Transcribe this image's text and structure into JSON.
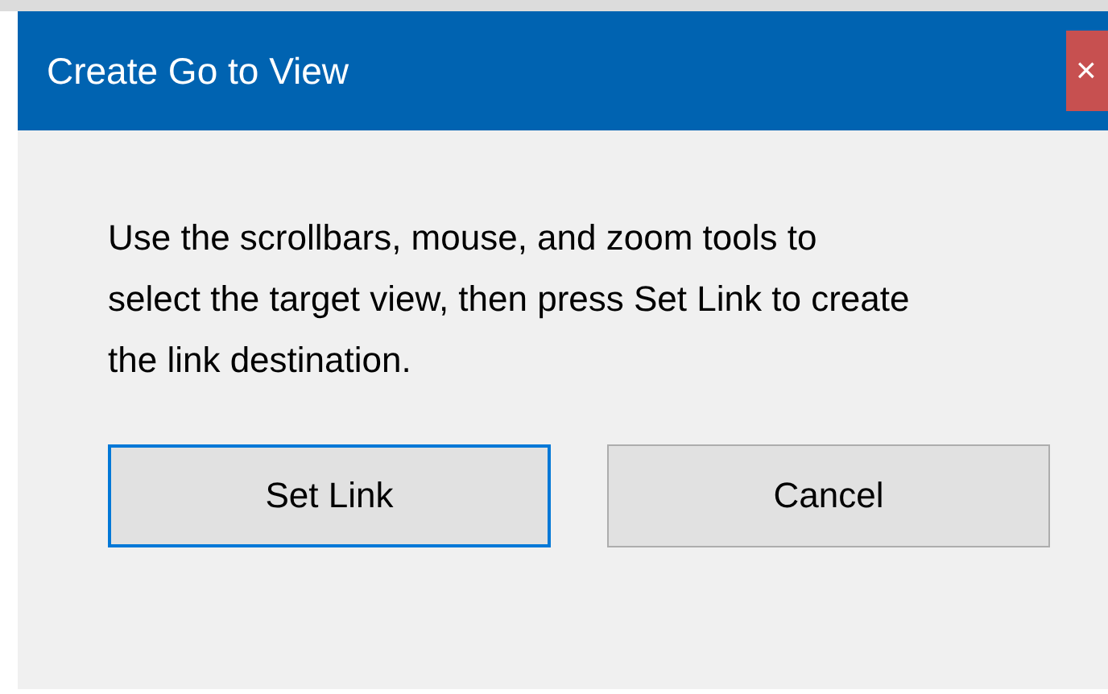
{
  "window": {
    "title": "Create Go to View",
    "close": "×"
  },
  "message": "Use the scrollbars, mouse, and zoom tools to select the target view, then press Set Link to create the link destination.",
  "buttons": [
    {
      "label": "Set Link",
      "focused": true
    },
    {
      "label": "Cancel",
      "focused": false
    }
  ]
}
